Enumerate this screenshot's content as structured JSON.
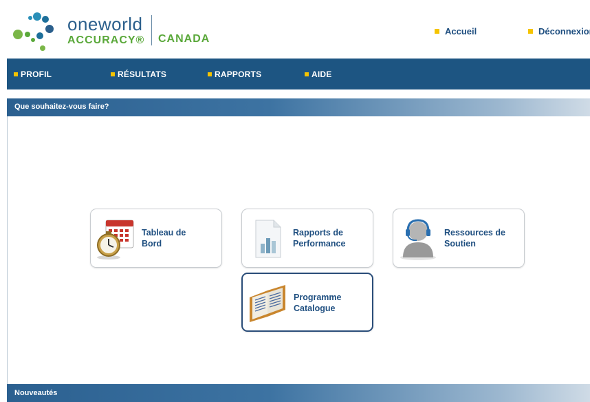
{
  "header": {
    "logo": {
      "name": "oneworld",
      "sub": "ACCURACY®",
      "country": "CANADA"
    },
    "links": [
      {
        "label": "Accueil"
      },
      {
        "label": "Déconnexion"
      }
    ]
  },
  "nav": {
    "items": [
      {
        "label": "PROFIL"
      },
      {
        "label": "RÉSULTATS"
      },
      {
        "label": "RAPPORTS"
      },
      {
        "label": "AIDE"
      }
    ]
  },
  "main": {
    "title": "Que souhaitez-vous faire?",
    "cards": [
      {
        "line1": "Tableau de",
        "line2": "Bord",
        "icon": "calendar-clock-icon"
      },
      {
        "line1": "Rapports de",
        "line2": "Performance",
        "icon": "report-chart-icon"
      },
      {
        "line1": "Ressources de",
        "line2": "Soutien",
        "icon": "support-headset-icon"
      },
      {
        "line1": "Programme",
        "line2": "Catalogue",
        "icon": "open-book-icon"
      }
    ]
  },
  "footer": {
    "title": "Nouveautés"
  },
  "colors": {
    "brand_blue": "#1d5582",
    "accent_yellow": "#f5c400",
    "logo_green": "#5aa83a",
    "link_blue": "#1f4f80"
  }
}
